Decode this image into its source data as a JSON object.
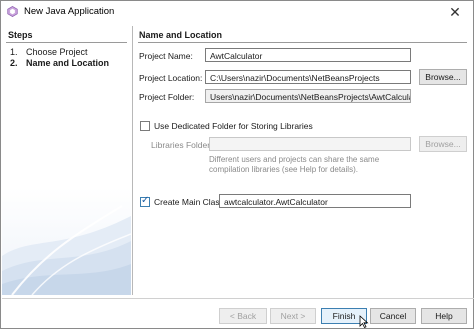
{
  "window": {
    "title": "New Java Application",
    "close_glyph": "✕"
  },
  "steps": {
    "title": "Steps",
    "items": [
      {
        "num": "1.",
        "label": "Choose Project"
      },
      {
        "num": "2.",
        "label": "Name and Location"
      }
    ]
  },
  "form": {
    "title": "Name and Location",
    "project_name_label": "Project Name:",
    "project_name_value": "AwtCalculator",
    "project_location_label": "Project Location:",
    "project_location_value": "C:\\Users\\nazir\\Documents\\NetBeansProjects",
    "browse_label": "Browse...",
    "project_folder_label": "Project Folder:",
    "project_folder_value": "Users\\nazir\\Documents\\NetBeansProjects\\AwtCalculator",
    "dedicated_folder_label": "Use Dedicated Folder for Storing Libraries",
    "dedicated_folder_checked": false,
    "libraries_folder_label": "Libraries Folder:",
    "libraries_folder_value": "",
    "libraries_browse_label": "Browse...",
    "libraries_note": "Different users and projects can share the same compilation libraries (see Help for details).",
    "create_main_class_label": "Create Main Class",
    "create_main_class_checked": true,
    "main_class_value": "awtcalculator.AwtCalculator"
  },
  "buttons": {
    "back": "< Back",
    "next": "Next >",
    "finish": "Finish",
    "cancel": "Cancel",
    "help": "Help"
  },
  "check_glyph": "✓"
}
